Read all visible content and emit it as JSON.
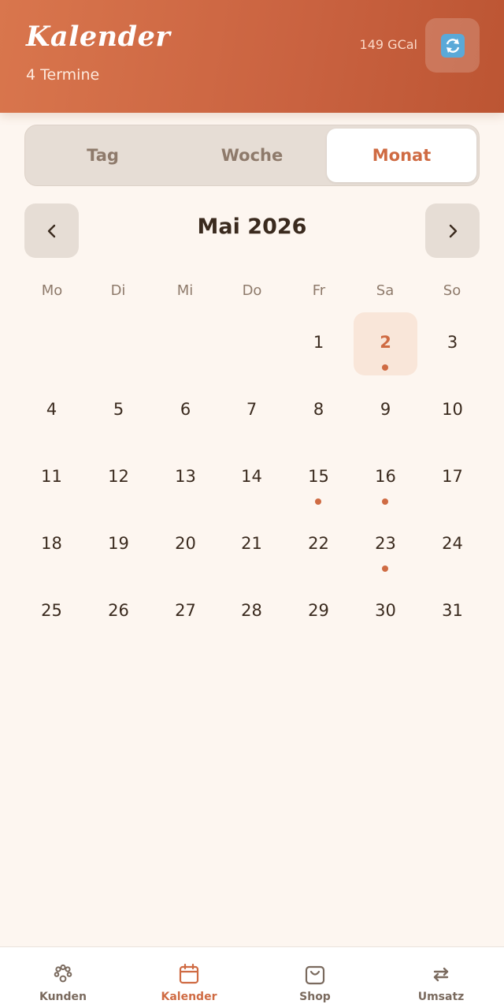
{
  "header": {
    "title": "Kalender",
    "subtitle": "4 Termine",
    "credits": "149 GCal"
  },
  "view_switcher": {
    "tabs": [
      {
        "label": "Tag"
      },
      {
        "label": "Woche"
      },
      {
        "label": "Monat",
        "active": true
      }
    ]
  },
  "month_nav": {
    "title": "Mai 2026"
  },
  "weekdays": [
    "Mo",
    "Di",
    "Mi",
    "Do",
    "Fr",
    "Sa",
    "So"
  ],
  "days": [
    {
      "label": "1"
    },
    {
      "label": "2",
      "selected": true,
      "has_event": true
    },
    {
      "label": "3"
    },
    {
      "label": "4"
    },
    {
      "label": "5"
    },
    {
      "label": "6"
    },
    {
      "label": "7"
    },
    {
      "label": "8"
    },
    {
      "label": "9"
    },
    {
      "label": "10"
    },
    {
      "label": "11"
    },
    {
      "label": "12"
    },
    {
      "label": "13"
    },
    {
      "label": "14"
    },
    {
      "label": "15",
      "has_event": true
    },
    {
      "label": "16",
      "has_event": true
    },
    {
      "label": "17"
    },
    {
      "label": "18"
    },
    {
      "label": "19"
    },
    {
      "label": "20"
    },
    {
      "label": "21"
    },
    {
      "label": "22"
    },
    {
      "label": "23",
      "has_event": true
    },
    {
      "label": "24"
    },
    {
      "label": "25"
    },
    {
      "label": "26"
    },
    {
      "label": "27"
    },
    {
      "label": "28"
    },
    {
      "label": "29"
    },
    {
      "label": "30"
    },
    {
      "label": "31"
    }
  ],
  "bottom_nav": {
    "items": [
      {
        "label": "Kunden",
        "icon": "paw-icon"
      },
      {
        "label": "Kalender",
        "icon": "calendar-icon",
        "active": true
      },
      {
        "label": "Shop",
        "icon": "shopping-bag-icon"
      },
      {
        "label": "Umsatz",
        "icon": "exchange-icon"
      }
    ]
  },
  "colors": {
    "accent": "#cf6b43",
    "header_start": "#d9764d",
    "header_end": "#bc5533",
    "background": "#fdf6f0",
    "event_dot": "#cf6b43"
  }
}
